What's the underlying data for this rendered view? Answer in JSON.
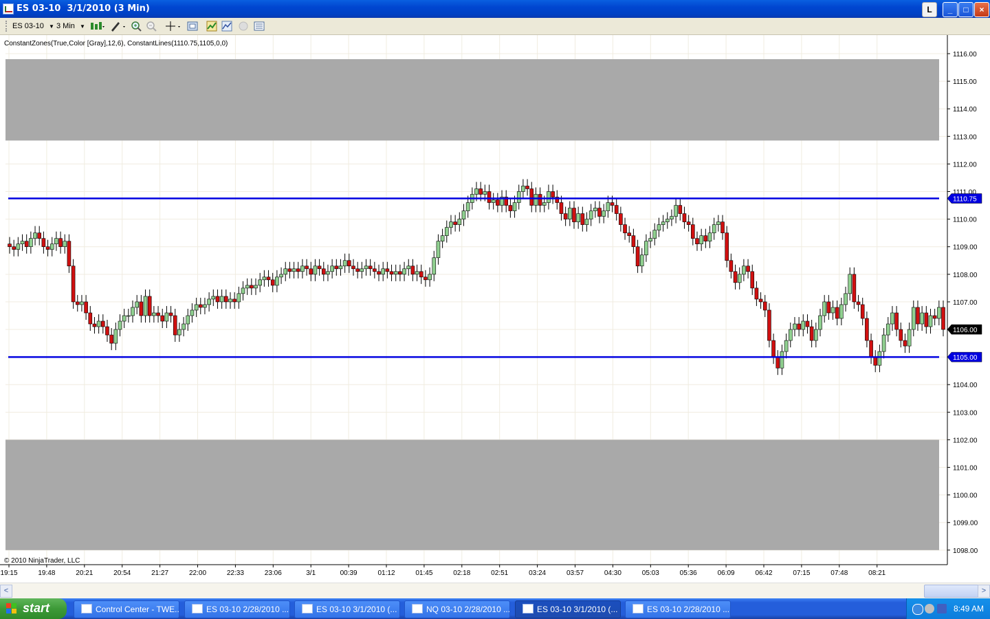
{
  "window": {
    "title": "ES 03-10  3/1/2010 (3 Min)",
    "buttons": {
      "link": "L",
      "minimize": "_",
      "maximize": "□",
      "close": "×"
    }
  },
  "toolbar": {
    "instrument": "ES 03-10",
    "interval": "3 Min",
    "icons": [
      "bar-type-icon",
      "drawing-tools-icon",
      "zoom-in-icon",
      "zoom-out-icon",
      "crosshair-icon",
      "snapshot-icon",
      "data-box-icon",
      "indicators-icon",
      "strategies-icon",
      "properties-icon"
    ]
  },
  "chart_data": {
    "type": "candlestick",
    "indicator_label": "ConstantZones(True,Color [Gray],12,6), ConstantLines(1110.75,1105,0,0)",
    "copyright": "© 2010 NinjaTrader, LLC",
    "ylim": [
      1097.0,
      1116.5
    ],
    "y_ticks": [
      "1116.00",
      "1115.00",
      "1114.00",
      "1113.00",
      "1112.00",
      "1111.00",
      "1110.00",
      "1109.00",
      "1108.00",
      "1107.00",
      "1106.00",
      "1105.00",
      "1104.00",
      "1103.00",
      "1102.00",
      "1101.00",
      "1100.00",
      "1099.00",
      "1098.00"
    ],
    "x_ticks": [
      "19:15",
      "19:48",
      "20:21",
      "20:54",
      "21:27",
      "22:00",
      "22:33",
      "23:06",
      "3/1",
      "00:39",
      "01:12",
      "01:45",
      "02:18",
      "02:51",
      "03:24",
      "03:57",
      "04:30",
      "05:03",
      "05:36",
      "06:09",
      "06:42",
      "07:15",
      "07:48",
      "08:21"
    ],
    "zones": [
      {
        "from": 1112.85,
        "to": 1115.8,
        "color": "#a9a9a9"
      },
      {
        "from": 1098.0,
        "to": 1102.0,
        "color": "#a9a9a9"
      }
    ],
    "lines": [
      {
        "value": 1110.75,
        "label": "1110.75",
        "color": "#0000e0"
      },
      {
        "value": 1105.0,
        "label": "1105.00",
        "color": "#0000e0"
      }
    ],
    "last_price": {
      "value": 1106.0,
      "label": "1106.00"
    },
    "up_color": "#90d090",
    "down_color": "#d01010",
    "closes": [
      1109.0,
      1108.9,
      1109.1,
      1109.2,
      1109.0,
      1109.3,
      1109.5,
      1109.3,
      1109.0,
      1108.9,
      1109.1,
      1109.3,
      1109.0,
      1109.2,
      1108.3,
      1107.0,
      1106.9,
      1107.0,
      1106.6,
      1106.2,
      1106.1,
      1106.3,
      1106.1,
      1105.8,
      1105.5,
      1106.0,
      1106.3,
      1106.5,
      1106.5,
      1106.8,
      1107.0,
      1106.5,
      1107.2,
      1106.5,
      1106.6,
      1106.5,
      1106.3,
      1106.6,
      1106.5,
      1105.8,
      1106.0,
      1106.2,
      1106.5,
      1106.7,
      1106.9,
      1106.8,
      1106.9,
      1107.1,
      1107.2,
      1107.0,
      1107.2,
      1107.0,
      1107.1,
      1107.0,
      1107.3,
      1107.5,
      1107.6,
      1107.5,
      1107.6,
      1107.8,
      1107.9,
      1107.8,
      1107.6,
      1107.9,
      1108.0,
      1108.2,
      1108.1,
      1108.2,
      1108.1,
      1108.3,
      1108.2,
      1108.0,
      1108.3,
      1108.2,
      1108.0,
      1108.1,
      1108.3,
      1108.2,
      1108.3,
      1108.5,
      1108.3,
      1108.2,
      1108.1,
      1108.2,
      1108.3,
      1108.2,
      1108.1,
      1108.0,
      1108.2,
      1108.1,
      1108.0,
      1108.1,
      1108.0,
      1108.2,
      1108.3,
      1108.0,
      1108.1,
      1107.9,
      1107.8,
      1108.0,
      1108.6,
      1109.2,
      1109.4,
      1109.7,
      1109.9,
      1109.8,
      1110.0,
      1110.3,
      1110.6,
      1110.9,
      1111.1,
      1110.9,
      1111.0,
      1110.6,
      1110.7,
      1110.5,
      1110.8,
      1110.5,
      1110.3,
      1110.6,
      1111.0,
      1111.2,
      1111.1,
      1110.5,
      1110.9,
      1110.5,
      1110.6,
      1111.0,
      1110.8,
      1110.6,
      1110.2,
      1110.0,
      1110.4,
      1109.9,
      1110.2,
      1109.8,
      1110.0,
      1110.3,
      1110.4,
      1110.1,
      1110.3,
      1110.6,
      1110.5,
      1110.2,
      1109.8,
      1109.5,
      1109.4,
      1109.0,
      1108.3,
      1108.7,
      1109.2,
      1109.3,
      1109.6,
      1109.8,
      1109.9,
      1110.0,
      1110.1,
      1110.5,
      1110.2,
      1109.9,
      1109.8,
      1109.3,
      1109.1,
      1109.4,
      1109.2,
      1109.5,
      1109.8,
      1109.9,
      1109.5,
      1108.5,
      1108.1,
      1107.7,
      1108.0,
      1108.3,
      1108.1,
      1107.5,
      1107.1,
      1107.0,
      1106.7,
      1105.6,
      1105.0,
      1104.6,
      1105.2,
      1105.6,
      1106.0,
      1106.2,
      1106.0,
      1106.3,
      1106.1,
      1105.6,
      1106.0,
      1106.5,
      1107.0,
      1106.6,
      1106.8,
      1106.4,
      1106.9,
      1107.3,
      1108.0,
      1107.0,
      1106.9,
      1106.4,
      1105.6,
      1105.0,
      1104.7,
      1105.2,
      1105.8,
      1106.2,
      1106.6,
      1106.0,
      1105.6,
      1105.4,
      1106.0,
      1106.8,
      1106.2,
      1106.6,
      1106.1,
      1106.5,
      1106.4,
      1106.8,
      1106.0
    ]
  },
  "scrollbar": {
    "left_arrow": "<",
    "right_arrow": ">"
  },
  "taskbar": {
    "start": "start",
    "tasks": [
      {
        "label": "Control Center - TWE..."
      },
      {
        "label": "ES 03-10  2/28/2010 ..."
      },
      {
        "label": "ES 03-10  3/1/2010 (..."
      },
      {
        "label": "NQ 03-10  2/28/2010 ..."
      },
      {
        "label": "ES 03-10  3/1/2010 (..."
      },
      {
        "label": "ES 03-10  2/28/2010 ..."
      }
    ],
    "active_index": 4,
    "clock": "8:49 AM"
  }
}
